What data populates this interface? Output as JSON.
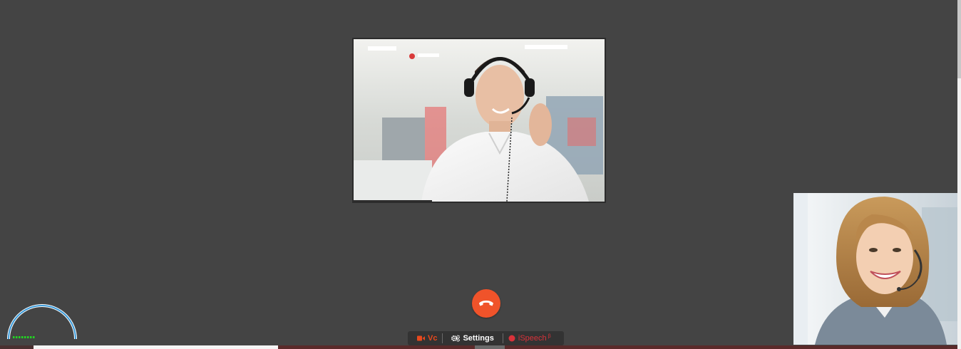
{
  "toolbar": {
    "vc_label": "Vc",
    "settings_label": "Settings",
    "ispeech_label": "iSpeech",
    "ispeech_superscript": "β"
  },
  "icons": {
    "hangup": "phone-hangup-icon",
    "video": "video-camera-icon",
    "settings": "gears-icon",
    "record": "record-dot-icon"
  },
  "colors": {
    "background": "#444444",
    "hangup": "#f0532a",
    "vc": "#e8491d",
    "ispeech": "#d9323a",
    "gauge_arc": "#3a9ad9",
    "gauge_level": "#22d422"
  },
  "audio_meter": {
    "level_segments": 8
  }
}
